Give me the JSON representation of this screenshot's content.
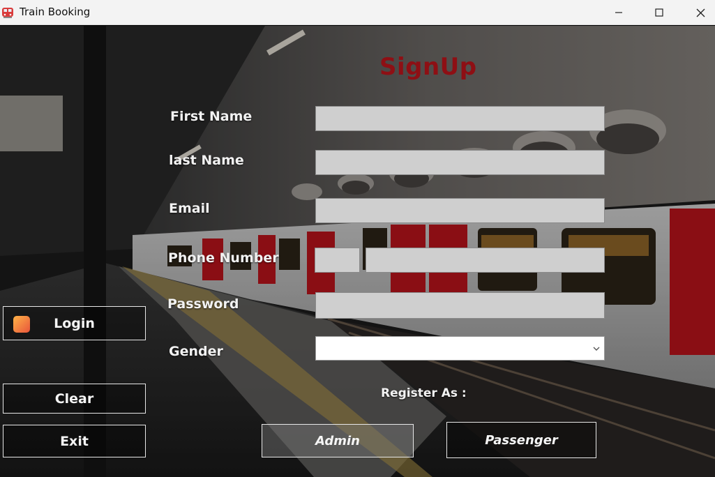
{
  "window": {
    "title": "Train Booking",
    "minimize_icon": "minimize-icon",
    "maximize_icon": "maximize-icon",
    "close_icon": "close-icon"
  },
  "form": {
    "heading": "SignUp",
    "first_name_label": "First Name",
    "last_name_label": "last Name",
    "email_label": "Email",
    "phone_label": "Phone Number",
    "password_label": "Password",
    "gender_label": "Gender",
    "first_name_value": "",
    "last_name_value": "",
    "email_value": "",
    "phone_code_value": "",
    "phone_number_value": "",
    "password_value": "",
    "gender_value": "",
    "register_as_label": "Register As :"
  },
  "buttons": {
    "login": "Login",
    "clear": "Clear",
    "exit": "Exit",
    "admin": "Admin",
    "passenger": "Passenger"
  },
  "colors": {
    "heading": "#8e0f14",
    "input_bg": "#cfcfcf",
    "train_red": "#c0141c"
  }
}
